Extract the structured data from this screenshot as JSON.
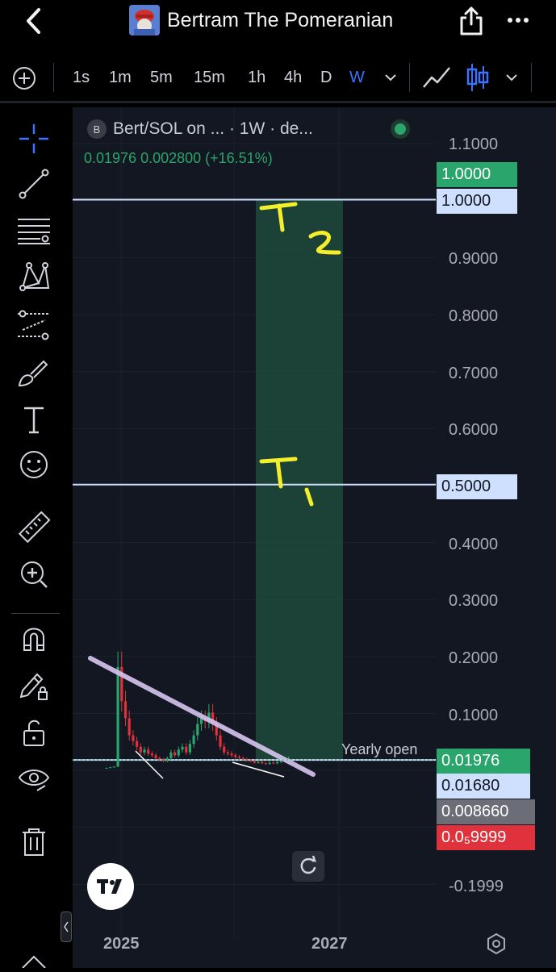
{
  "header": {
    "title": "Bertram The Pomeranian",
    "back_icon": "chevron-left-icon",
    "share_icon": "share-icon",
    "more_icon": "more-icon"
  },
  "toolbar": {
    "add_icon": "plus-circle-icon",
    "timeframes": [
      "1s",
      "1m",
      "5m",
      "15m",
      "1h",
      "4h",
      "D",
      "W"
    ],
    "active_timeframe": "W",
    "chart_style_icons": [
      "line-chart-icon",
      "candles-icon"
    ],
    "accent_color": "#3a73ff"
  },
  "left_tools": [
    "crosshair-icon",
    "trend-line-icon",
    "fib-icon",
    "pattern-icon",
    "prediction-icon",
    "brush-icon",
    "text-icon",
    "emoji-icon",
    "ruler-icon",
    "zoom-in-icon",
    "magnet-icon",
    "lock-drawing-icon",
    "unlock-icon",
    "eye-icon",
    "trash-icon"
  ],
  "legend": {
    "symbol_badge": "B",
    "title": "Bert/SOL on ...  · 1W · de...",
    "values": "0.01976  0.002800 (+16.51%)",
    "value_color": "#2aa56c"
  },
  "annotations": {
    "t2": "T2",
    "t1": "T1",
    "yearly_open": "Yearly open"
  },
  "price_labels": {
    "green_target": "1.0000",
    "line_top": "1.0000",
    "line_mid": "0.5000",
    "current": "0.01976",
    "line_low": "0.01680",
    "grey": "0.008660",
    "red": "0.0₅9999"
  },
  "colors": {
    "green": "#2aa56c",
    "red": "#e0323c",
    "h_line": "#cfe0ff",
    "trend_line": "#d8c6f0",
    "target_zone": "#1f4a3b",
    "background": "#131722"
  },
  "chart_data": {
    "type": "candlestick",
    "title": "Bert/SOL on ... · 1W · de...",
    "y_ticks": [
      "1.1000",
      "0.9000",
      "0.8000",
      "0.7000",
      "0.6000",
      "0.4000",
      "0.3000",
      "0.2000",
      "0.1000",
      "-0.1999"
    ],
    "x_ticks": [
      "2025",
      "2027"
    ],
    "ylim": [
      -0.1999,
      1.1
    ],
    "horizontal_lines": [
      1.0,
      0.5,
      0.0168
    ],
    "last_price": 0.01976,
    "change": 0.0028,
    "change_pct": 16.51,
    "peak_price": 0.18,
    "target_zone": {
      "low": 0.0168,
      "high": 1.0
    }
  }
}
